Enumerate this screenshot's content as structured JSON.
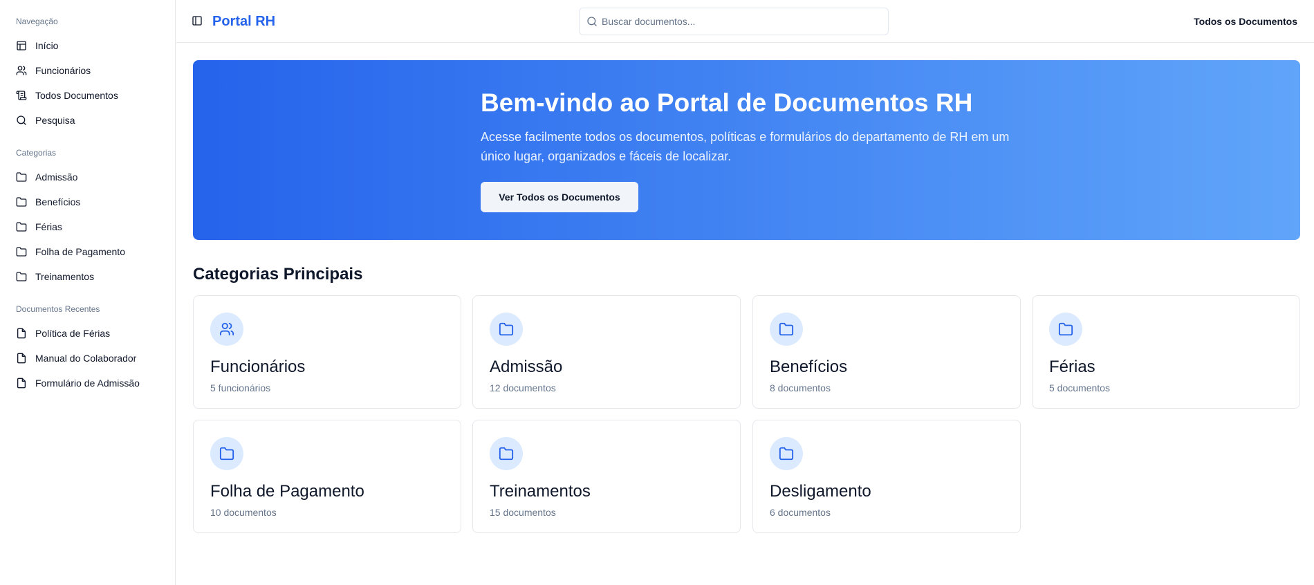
{
  "sidebar": {
    "groups": [
      {
        "title": "Navegação",
        "items": [
          {
            "label": "Início",
            "icon": "layout-icon"
          },
          {
            "label": "Funcionários",
            "icon": "users-icon"
          },
          {
            "label": "Todos Documentos",
            "icon": "scroll-icon"
          },
          {
            "label": "Pesquisa",
            "icon": "search-icon"
          }
        ]
      },
      {
        "title": "Categorias",
        "items": [
          {
            "label": "Admissão",
            "icon": "folder-icon"
          },
          {
            "label": "Benefícios",
            "icon": "folder-icon"
          },
          {
            "label": "Férias",
            "icon": "folder-icon"
          },
          {
            "label": "Folha de Pagamento",
            "icon": "folder-icon"
          },
          {
            "label": "Treinamentos",
            "icon": "folder-icon"
          }
        ]
      },
      {
        "title": "Documentos Recentes",
        "items": [
          {
            "label": "Política de Férias",
            "icon": "file-icon"
          },
          {
            "label": "Manual do Colaborador",
            "icon": "file-icon"
          },
          {
            "label": "Formulário de Admissão",
            "icon": "file-icon"
          }
        ]
      }
    ]
  },
  "header": {
    "brand": "Portal RH",
    "search_placeholder": "Buscar documentos...",
    "search_value": "",
    "link": "Todos os Documentos"
  },
  "hero": {
    "title": "Bem-vindo ao Portal de Documentos RH",
    "subtitle": "Acesse facilmente todos os documentos, políticas e formulários do departamento de RH em um único lugar, organizados e fáceis de localizar.",
    "button": "Ver Todos os Documentos"
  },
  "main": {
    "section_title": "Categorias Principais",
    "cards": [
      {
        "title": "Funcionários",
        "count": "5 funcionários",
        "icon": "users-icon"
      },
      {
        "title": "Admissão",
        "count": "12 documentos",
        "icon": "folder-icon"
      },
      {
        "title": "Benefícios",
        "count": "8 documentos",
        "icon": "folder-icon"
      },
      {
        "title": "Férias",
        "count": "5 documentos",
        "icon": "folder-icon"
      },
      {
        "title": "Folha de Pagamento",
        "count": "10 documentos",
        "icon": "folder-icon"
      },
      {
        "title": "Treinamentos",
        "count": "15 documentos",
        "icon": "folder-icon"
      },
      {
        "title": "Desligamento",
        "count": "6 documentos",
        "icon": "folder-icon"
      }
    ]
  },
  "colors": {
    "accent": "#2563eb",
    "hero_start": "#2563eb",
    "hero_end": "#60a5fa",
    "icon_bg": "#dbeafe"
  }
}
